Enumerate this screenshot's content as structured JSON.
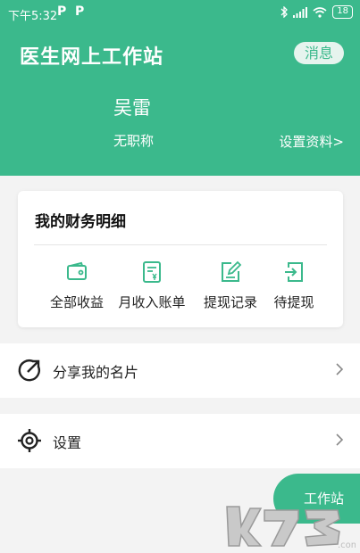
{
  "status_bar": {
    "time": "下午5:32",
    "p1": "P",
    "p2": "P",
    "battery": "18"
  },
  "header": {
    "title": "医生网上工作站",
    "message_button": "消息"
  },
  "profile": {
    "name": "吴雷",
    "title": "无职称",
    "settings_link": "设置资料>"
  },
  "finance": {
    "title": "我的财务明细",
    "items": [
      {
        "label": "全部收益",
        "icon": "wallet-icon"
      },
      {
        "label": "月收入账单",
        "icon": "bill-icon"
      },
      {
        "label": "提现记录",
        "icon": "edit-record-icon"
      },
      {
        "label": "待提现",
        "icon": "withdraw-icon"
      }
    ]
  },
  "menu": [
    {
      "label": "分享我的名片",
      "icon": "share-icon"
    },
    {
      "label": "设置",
      "icon": "settings-gear-icon"
    }
  ],
  "fab": {
    "label": "工作站"
  },
  "watermark": {
    "text": "k73"
  },
  "colors": {
    "brand_green": "#3bb98c",
    "background": "#f3f3f3",
    "watermark_grey": "#b0b0b0"
  }
}
